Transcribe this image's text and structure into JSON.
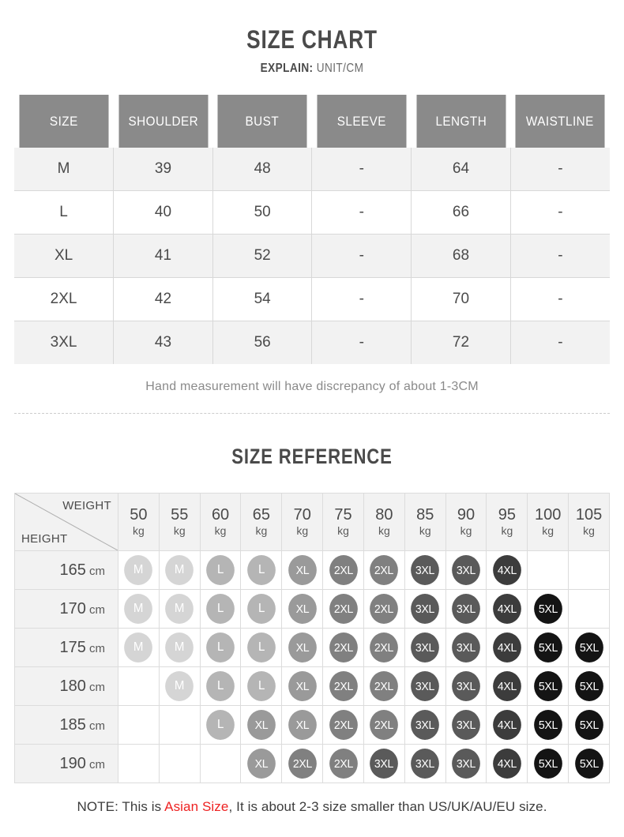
{
  "header": {
    "title": "SIZE CHART",
    "explain_label": "EXPLAIN:",
    "explain_value": "UNIT/CM"
  },
  "size_chart": {
    "columns": [
      "SIZE",
      "SHOULDER",
      "BUST",
      "SLEEVE",
      "LENGTH",
      "WAISTLINE"
    ],
    "rows": [
      [
        "M",
        "39",
        "48",
        "-",
        "64",
        "-"
      ],
      [
        "L",
        "40",
        "50",
        "-",
        "66",
        "-"
      ],
      [
        "XL",
        "41",
        "52",
        "-",
        "68",
        "-"
      ],
      [
        "2XL",
        "42",
        "54",
        "-",
        "70",
        "-"
      ],
      [
        "3XL",
        "43",
        "56",
        "-",
        "72",
        "-"
      ]
    ],
    "note": "Hand measurement will have discrepancy of about 1-3CM"
  },
  "size_reference": {
    "title": "SIZE REFERENCE",
    "corner": {
      "weight_label": "WEIGHT",
      "height_label": "HEIGHT"
    },
    "weight_unit": "kg",
    "weights": [
      "50",
      "55",
      "60",
      "65",
      "70",
      "75",
      "80",
      "85",
      "90",
      "95",
      "100",
      "105"
    ],
    "height_unit": "cm",
    "heights": [
      "165",
      "170",
      "175",
      "180",
      "185",
      "190"
    ],
    "grid": [
      [
        "M",
        "M",
        "L",
        "L",
        "XL",
        "2XL",
        "2XL",
        "3XL",
        "3XL",
        "4XL",
        "",
        ""
      ],
      [
        "M",
        "M",
        "L",
        "L",
        "XL",
        "2XL",
        "2XL",
        "3XL",
        "3XL",
        "4XL",
        "5XL",
        ""
      ],
      [
        "M",
        "M",
        "L",
        "L",
        "XL",
        "2XL",
        "2XL",
        "3XL",
        "3XL",
        "4XL",
        "5XL",
        "5XL"
      ],
      [
        "",
        "M",
        "L",
        "L",
        "XL",
        "2XL",
        "2XL",
        "3XL",
        "3XL",
        "4XL",
        "5XL",
        "5XL"
      ],
      [
        "",
        "",
        "L",
        "XL",
        "XL",
        "2XL",
        "2XL",
        "3XL",
        "3XL",
        "4XL",
        "5XL",
        "5XL"
      ],
      [
        "",
        "",
        "",
        "XL",
        "2XL",
        "2XL",
        "3XL",
        "3XL",
        "3XL",
        "4XL",
        "5XL",
        "5XL"
      ]
    ]
  },
  "footer": {
    "prefix": "NOTE: This is ",
    "highlight": "Asian Size",
    "suffix": ", It is about 2-3 size smaller than US/UK/AU/EU size."
  },
  "colors": {
    "header_bg": "#8a8a8a",
    "row_alt": "#f2f2f2",
    "text": "#4a4a4a",
    "highlight": "#ee2222",
    "badge_M": "#d5d5d5",
    "badge_L": "#b5b5b5",
    "badge_XL": "#9a9a9a",
    "badge_2XL": "#808080",
    "badge_3XL": "#5a5a5a",
    "badge_4XL": "#3c3c3c",
    "badge_5XL": "#141414"
  }
}
